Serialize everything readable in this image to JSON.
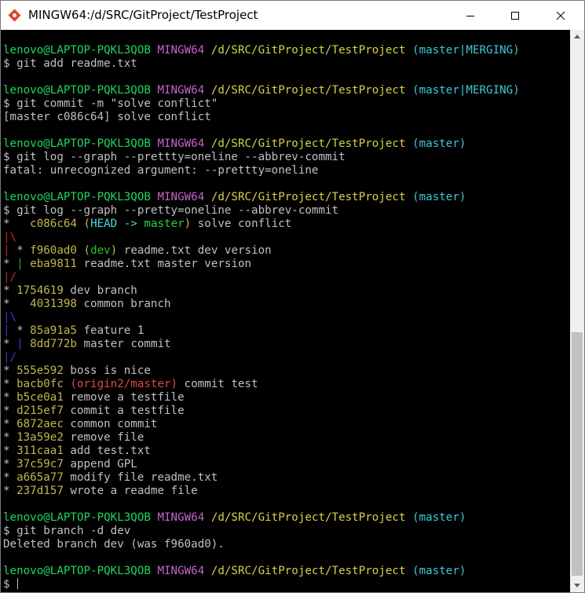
{
  "window": {
    "title": "MINGW64:/d/SRC/GitProject/TestProject"
  },
  "colors": {
    "default": "#c0c0c0",
    "user_host": "#1ed760",
    "shell": "#c864c8",
    "path": "#d4d24a",
    "branch": "#3ec9d6",
    "hash": "#c0b74c",
    "graph_red": "#c42b2b",
    "graph_green": "#1bb61b",
    "graph_blue": "#3b3bd6",
    "head_cyan": "#4ed5e0",
    "master_green": "#27d046",
    "dev_green": "#27c227",
    "origin_red": "#e04848"
  },
  "terminal": {
    "lines": [
      [
        [
          "lenovo@LAPTOP-PQKL3QOB",
          "user_host"
        ],
        [
          " ",
          "default"
        ],
        [
          "MINGW64",
          "shell"
        ],
        [
          " ",
          "default"
        ],
        [
          "/d/SRC/GitProject/TestProject",
          "path"
        ],
        [
          " ",
          "default"
        ],
        [
          "(master|MERGING)",
          "branch"
        ]
      ],
      [
        [
          "$ git add readme.txt",
          "default"
        ]
      ],
      [
        [
          "",
          "default"
        ]
      ],
      [
        [
          "lenovo@LAPTOP-PQKL3QOB",
          "user_host"
        ],
        [
          " ",
          "default"
        ],
        [
          "MINGW64",
          "shell"
        ],
        [
          " ",
          "default"
        ],
        [
          "/d/SRC/GitProject/TestProject",
          "path"
        ],
        [
          " ",
          "default"
        ],
        [
          "(master|MERGING)",
          "branch"
        ]
      ],
      [
        [
          "$ git commit -m \"solve conflict\"",
          "default"
        ]
      ],
      [
        [
          "[master c086c64] solve conflict",
          "default"
        ]
      ],
      [
        [
          "",
          "default"
        ]
      ],
      [
        [
          "lenovo@LAPTOP-PQKL3QOB",
          "user_host"
        ],
        [
          " ",
          "default"
        ],
        [
          "MINGW64",
          "shell"
        ],
        [
          " ",
          "default"
        ],
        [
          "/d/SRC/GitProject/TestProject",
          "path"
        ],
        [
          " ",
          "default"
        ],
        [
          "(master)",
          "branch"
        ]
      ],
      [
        [
          "$ git log --graph --prettty=oneline --abbrev-commit",
          "default"
        ]
      ],
      [
        [
          "fatal: unrecognized argument: --prettty=oneline",
          "default"
        ]
      ],
      [
        [
          "",
          "default"
        ]
      ],
      [
        [
          "lenovo@LAPTOP-PQKL3QOB",
          "user_host"
        ],
        [
          " ",
          "default"
        ],
        [
          "MINGW64",
          "shell"
        ],
        [
          " ",
          "default"
        ],
        [
          "/d/SRC/GitProject/TestProject",
          "path"
        ],
        [
          " ",
          "default"
        ],
        [
          "(master)",
          "branch"
        ]
      ],
      [
        [
          "$ git log --graph --pretty=oneline --abbrev-commit",
          "default"
        ]
      ],
      [
        [
          "*   ",
          "default"
        ],
        [
          "c086c64",
          "hash"
        ],
        [
          " ",
          "default"
        ],
        [
          "(",
          "hash"
        ],
        [
          "HEAD -> ",
          "head_cyan"
        ],
        [
          "master",
          "master_green"
        ],
        [
          ")",
          "hash"
        ],
        [
          " solve conflict",
          "default"
        ]
      ],
      [
        [
          "|\\",
          "graph_red"
        ]
      ],
      [
        [
          "|",
          "graph_red"
        ],
        [
          " * ",
          "default"
        ],
        [
          "f960ad0",
          "hash"
        ],
        [
          " ",
          "default"
        ],
        [
          "(",
          "hash"
        ],
        [
          "dev",
          "dev_green"
        ],
        [
          ")",
          "hash"
        ],
        [
          " readme.txt dev version",
          "default"
        ]
      ],
      [
        [
          "*",
          "default"
        ],
        [
          " ",
          "default"
        ],
        [
          "|",
          "graph_green"
        ],
        [
          " ",
          "default"
        ],
        [
          "eba9811",
          "hash"
        ],
        [
          " readme.txt master version",
          "default"
        ]
      ],
      [
        [
          "|/",
          "graph_red"
        ]
      ],
      [
        [
          "* ",
          "default"
        ],
        [
          "1754619",
          "hash"
        ],
        [
          " dev branch",
          "default"
        ]
      ],
      [
        [
          "*   ",
          "default"
        ],
        [
          "4031398",
          "hash"
        ],
        [
          " common branch",
          "default"
        ]
      ],
      [
        [
          "|\\",
          "graph_blue"
        ]
      ],
      [
        [
          "|",
          "graph_blue"
        ],
        [
          " * ",
          "default"
        ],
        [
          "85a91a5",
          "hash"
        ],
        [
          " feature 1",
          "default"
        ]
      ],
      [
        [
          "*",
          "default"
        ],
        [
          " ",
          "default"
        ],
        [
          "|",
          "graph_blue"
        ],
        [
          " ",
          "default"
        ],
        [
          "8dd772b",
          "hash"
        ],
        [
          " master commit",
          "default"
        ]
      ],
      [
        [
          "|/",
          "graph_blue"
        ]
      ],
      [
        [
          "* ",
          "default"
        ],
        [
          "555e592",
          "hash"
        ],
        [
          " boss is nice",
          "default"
        ]
      ],
      [
        [
          "* ",
          "default"
        ],
        [
          "bacb0fc",
          "hash"
        ],
        [
          " ",
          "default"
        ],
        [
          "(origin2/master)",
          "origin_red"
        ],
        [
          " commit test",
          "default"
        ]
      ],
      [
        [
          "* ",
          "default"
        ],
        [
          "b5ce0a1",
          "hash"
        ],
        [
          " remove a testfile",
          "default"
        ]
      ],
      [
        [
          "* ",
          "default"
        ],
        [
          "d215ef7",
          "hash"
        ],
        [
          " commit a testfile",
          "default"
        ]
      ],
      [
        [
          "* ",
          "default"
        ],
        [
          "6872aec",
          "hash"
        ],
        [
          " common commit",
          "default"
        ]
      ],
      [
        [
          "* ",
          "default"
        ],
        [
          "13a59e2",
          "hash"
        ],
        [
          " remove file",
          "default"
        ]
      ],
      [
        [
          "* ",
          "default"
        ],
        [
          "311caa1",
          "hash"
        ],
        [
          " add test.txt",
          "default"
        ]
      ],
      [
        [
          "* ",
          "default"
        ],
        [
          "37c59c7",
          "hash"
        ],
        [
          " append GPL",
          "default"
        ]
      ],
      [
        [
          "* ",
          "default"
        ],
        [
          "a665a77",
          "hash"
        ],
        [
          " modify file readme.txt",
          "default"
        ]
      ],
      [
        [
          "* ",
          "default"
        ],
        [
          "237d157",
          "hash"
        ],
        [
          " wrote a readme file",
          "default"
        ]
      ],
      [
        [
          "",
          "default"
        ]
      ],
      [
        [
          "lenovo@LAPTOP-PQKL3QOB",
          "user_host"
        ],
        [
          " ",
          "default"
        ],
        [
          "MINGW64",
          "shell"
        ],
        [
          " ",
          "default"
        ],
        [
          "/d/SRC/GitProject/TestProject",
          "path"
        ],
        [
          " ",
          "default"
        ],
        [
          "(master)",
          "branch"
        ]
      ],
      [
        [
          "$ git branch -d dev",
          "default"
        ]
      ],
      [
        [
          "Deleted branch dev (was f960ad0).",
          "default"
        ]
      ],
      [
        [
          "",
          "default"
        ]
      ],
      [
        [
          "lenovo@LAPTOP-PQKL3QOB",
          "user_host"
        ],
        [
          " ",
          "default"
        ],
        [
          "MINGW64",
          "shell"
        ],
        [
          " ",
          "default"
        ],
        [
          "/d/SRC/GitProject/TestProject",
          "path"
        ],
        [
          " ",
          "default"
        ],
        [
          "(master)",
          "branch"
        ]
      ],
      [
        [
          "$ ",
          "default"
        ]
      ]
    ]
  }
}
